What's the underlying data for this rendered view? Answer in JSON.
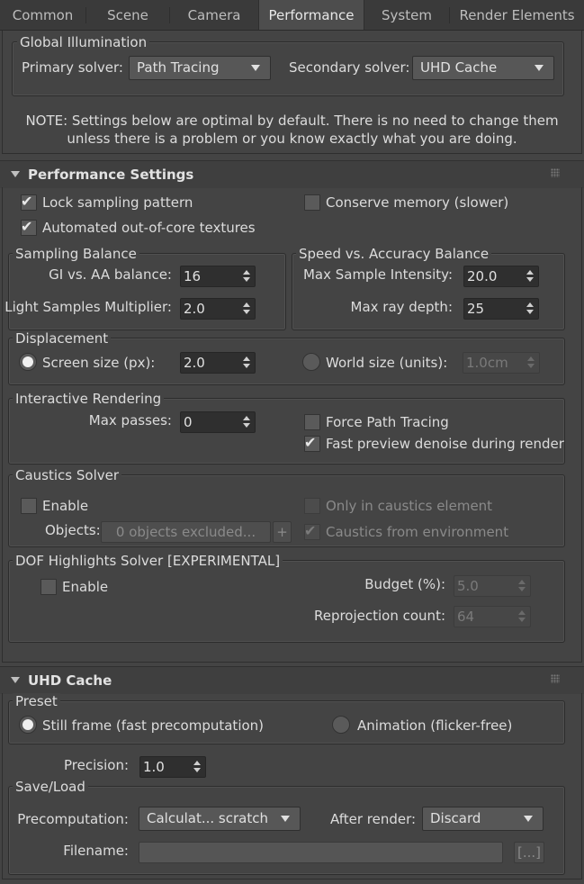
{
  "tabs": [
    "Common",
    "Scene",
    "Camera",
    "Performance",
    "System",
    "Render Elements"
  ],
  "gi": {
    "title": "Global Illumination",
    "primary_label": "Primary solver:",
    "primary_value": "Path Tracing",
    "secondary_label": "Secondary solver:",
    "secondary_value": "UHD Cache"
  },
  "note": {
    "line1": "NOTE: Settings below are optimal by default. There is no need to change them",
    "line2": "unless there is a problem or you know exactly what you are doing."
  },
  "perf": {
    "title": "Performance Settings",
    "lock_sampling": "Lock sampling pattern",
    "conserve_memory": "Conserve memory (slower)",
    "out_of_core": "Automated out-of-core textures",
    "sampling_balance": {
      "title": "Sampling Balance",
      "gi_aa_label": "GI vs. AA balance:",
      "gi_aa_value": "16",
      "light_mult_label": "Light Samples Multiplier:",
      "light_mult_value": "2.0"
    },
    "speed_accuracy": {
      "title": "Speed vs. Accuracy Balance",
      "max_intensity_label": "Max Sample Intensity:",
      "max_intensity_value": "20.0",
      "max_ray_label": "Max ray depth:",
      "max_ray_value": "25"
    },
    "displacement": {
      "title": "Displacement",
      "screen_label": "Screen size (px):",
      "screen_value": "2.0",
      "world_label": "World size (units):",
      "world_value": "1.0cm"
    },
    "interactive": {
      "title": "Interactive Rendering",
      "max_passes_label": "Max passes:",
      "max_passes_value": "0",
      "force_pt": "Force Path Tracing",
      "fast_preview": "Fast preview denoise during render"
    },
    "caustics": {
      "title": "Caustics Solver",
      "enable": "Enable",
      "only_caustics": "Only in caustics element",
      "objects_label": "Objects:",
      "objects_button": "0 objects excluded...",
      "plus": "+",
      "from_env": "Caustics from environment"
    },
    "dof": {
      "title": "DOF Highlights Solver [EXPERIMENTAL]",
      "enable": "Enable",
      "budget_label": "Budget (%):",
      "budget_value": "5.0",
      "reproj_label": "Reprojection count:",
      "reproj_value": "64"
    }
  },
  "uhd": {
    "title": "UHD Cache",
    "preset": {
      "title": "Preset",
      "still": "Still frame (fast precomputation)",
      "animation": "Animation (flicker-free)"
    },
    "precision_label": "Precision:",
    "precision_value": "1.0",
    "saveload": {
      "title": "Save/Load",
      "precomp_label": "Precomputation:",
      "precomp_value": "Calculat... scratch",
      "after_label": "After render:",
      "after_value": "Discard",
      "filename_label": "Filename:",
      "browse": "[...]"
    }
  }
}
